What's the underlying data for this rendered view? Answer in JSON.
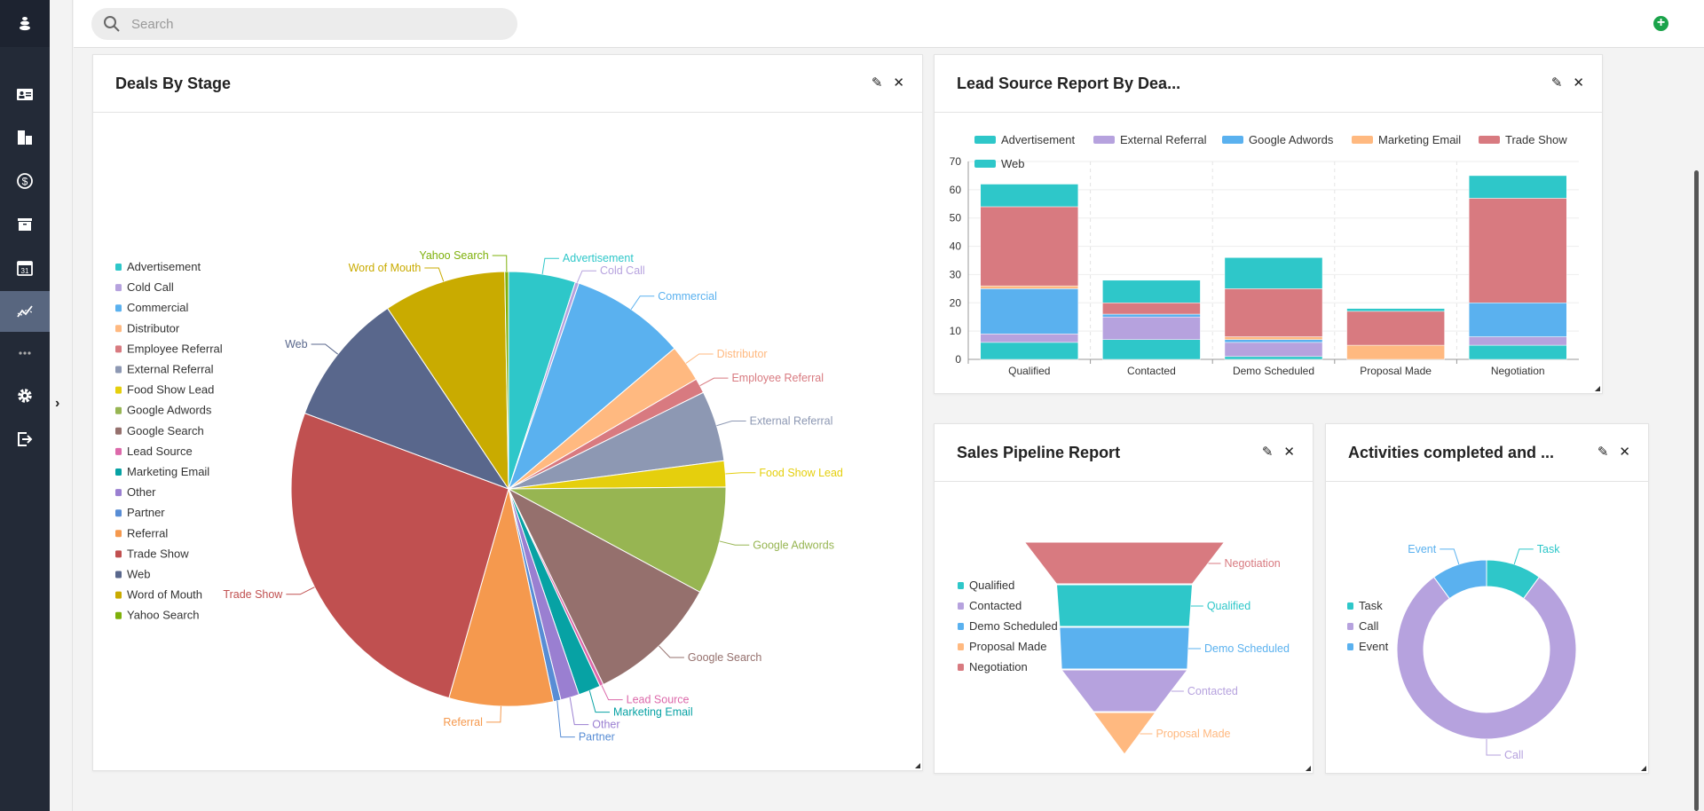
{
  "search": {
    "placeholder": "Search"
  },
  "sidebar": {
    "items": [
      {
        "icon": "contact-card-icon",
        "active": false
      },
      {
        "icon": "building-icon",
        "active": false
      },
      {
        "icon": "dollar-circle-icon",
        "active": false
      },
      {
        "icon": "archive-icon",
        "active": false
      },
      {
        "icon": "calendar-icon",
        "active": false
      },
      {
        "icon": "reports-chart-icon",
        "active": true
      },
      {
        "icon": "more-icon",
        "active": false
      },
      {
        "icon": "gear-icon",
        "active": false
      },
      {
        "icon": "logout-icon",
        "active": false
      }
    ]
  },
  "cards": {
    "deals": {
      "title": "Deals By Stage"
    },
    "lead": {
      "title": "Lead Source Report By Dea..."
    },
    "pipeline": {
      "title": "Sales Pipeline Report"
    },
    "activities": {
      "title": "Activities completed and ..."
    }
  },
  "chart_data": [
    {
      "type": "pie",
      "title": "Deals By Stage",
      "legend": "left",
      "categories": [
        "Advertisement",
        "Cold Call",
        "Commercial",
        "Distributor",
        "Employee Referral",
        "External Referral",
        "Food Show Lead",
        "Google Adwords",
        "Google Search",
        "Lead Source",
        "Marketing Email",
        "Other",
        "Partner",
        "Referral",
        "Trade Show",
        "Web",
        "Word of Mouth",
        "Yahoo Search"
      ],
      "values": [
        18,
        1,
        31,
        10,
        4,
        19,
        7,
        29,
        36,
        1,
        6,
        5,
        2,
        28,
        95,
        36,
        33,
        1
      ],
      "colors": [
        "#2ec7c9",
        "#b6a2de",
        "#5ab1ef",
        "#ffb980",
        "#d87a80",
        "#8d98b3",
        "#e5cf0d",
        "#97b552",
        "#95706d",
        "#dc69aa",
        "#07a2a4",
        "#9a7fd1",
        "#588dd5",
        "#f5994e",
        "#c05050",
        "#59678c",
        "#c9ab00",
        "#7eb00a"
      ]
    },
    {
      "type": "bar",
      "stacked": true,
      "title": "Lead Source Report By Dea...",
      "legend": "top",
      "grid": true,
      "categories": [
        "Qualified",
        "Contacted",
        "Demo Scheduled",
        "Proposal Made",
        "Negotiation"
      ],
      "ylim": [
        0,
        70
      ],
      "yticks": [
        0,
        10,
        20,
        30,
        40,
        50,
        60,
        70
      ],
      "series": [
        {
          "name": "Advertisement",
          "color": "#2ec7c9",
          "values": [
            6,
            7,
            1,
            0,
            5
          ]
        },
        {
          "name": "External Referral",
          "color": "#b6a2de",
          "values": [
            3,
            8,
            5,
            0,
            3
          ]
        },
        {
          "name": "Google Adwords",
          "color": "#5ab1ef",
          "values": [
            16,
            1,
            1,
            0,
            12
          ]
        },
        {
          "name": "Marketing Email",
          "color": "#ffb980",
          "values": [
            1,
            0,
            1,
            5,
            0
          ]
        },
        {
          "name": "Trade Show",
          "color": "#d87a80",
          "values": [
            28,
            4,
            17,
            12,
            37
          ]
        },
        {
          "name": "Web",
          "color": "#2ec7c9",
          "values": [
            8,
            8,
            11,
            1,
            8
          ]
        }
      ]
    },
    {
      "type": "funnel",
      "title": "Sales Pipeline Report",
      "legend": "left",
      "legend_order": [
        "Qualified",
        "Contacted",
        "Demo Scheduled",
        "Proposal Made",
        "Negotiation"
      ],
      "categories": [
        "Negotiation",
        "Qualified",
        "Demo Scheduled",
        "Contacted",
        "Proposal Made"
      ],
      "values": [
        100,
        68,
        65,
        63,
        31
      ],
      "colors": {
        "Qualified": "#2ec7c9",
        "Contacted": "#b6a2de",
        "Demo Scheduled": "#5ab1ef",
        "Proposal Made": "#ffb980",
        "Negotiation": "#d87a80"
      }
    },
    {
      "type": "pie",
      "donut": true,
      "title": "Activities completed and ...",
      "legend": "left",
      "categories": [
        "Task",
        "Call",
        "Event"
      ],
      "values": [
        1,
        8,
        1
      ],
      "colors": [
        "#2ec7c9",
        "#b6a2de",
        "#5ab1ef"
      ]
    }
  ]
}
